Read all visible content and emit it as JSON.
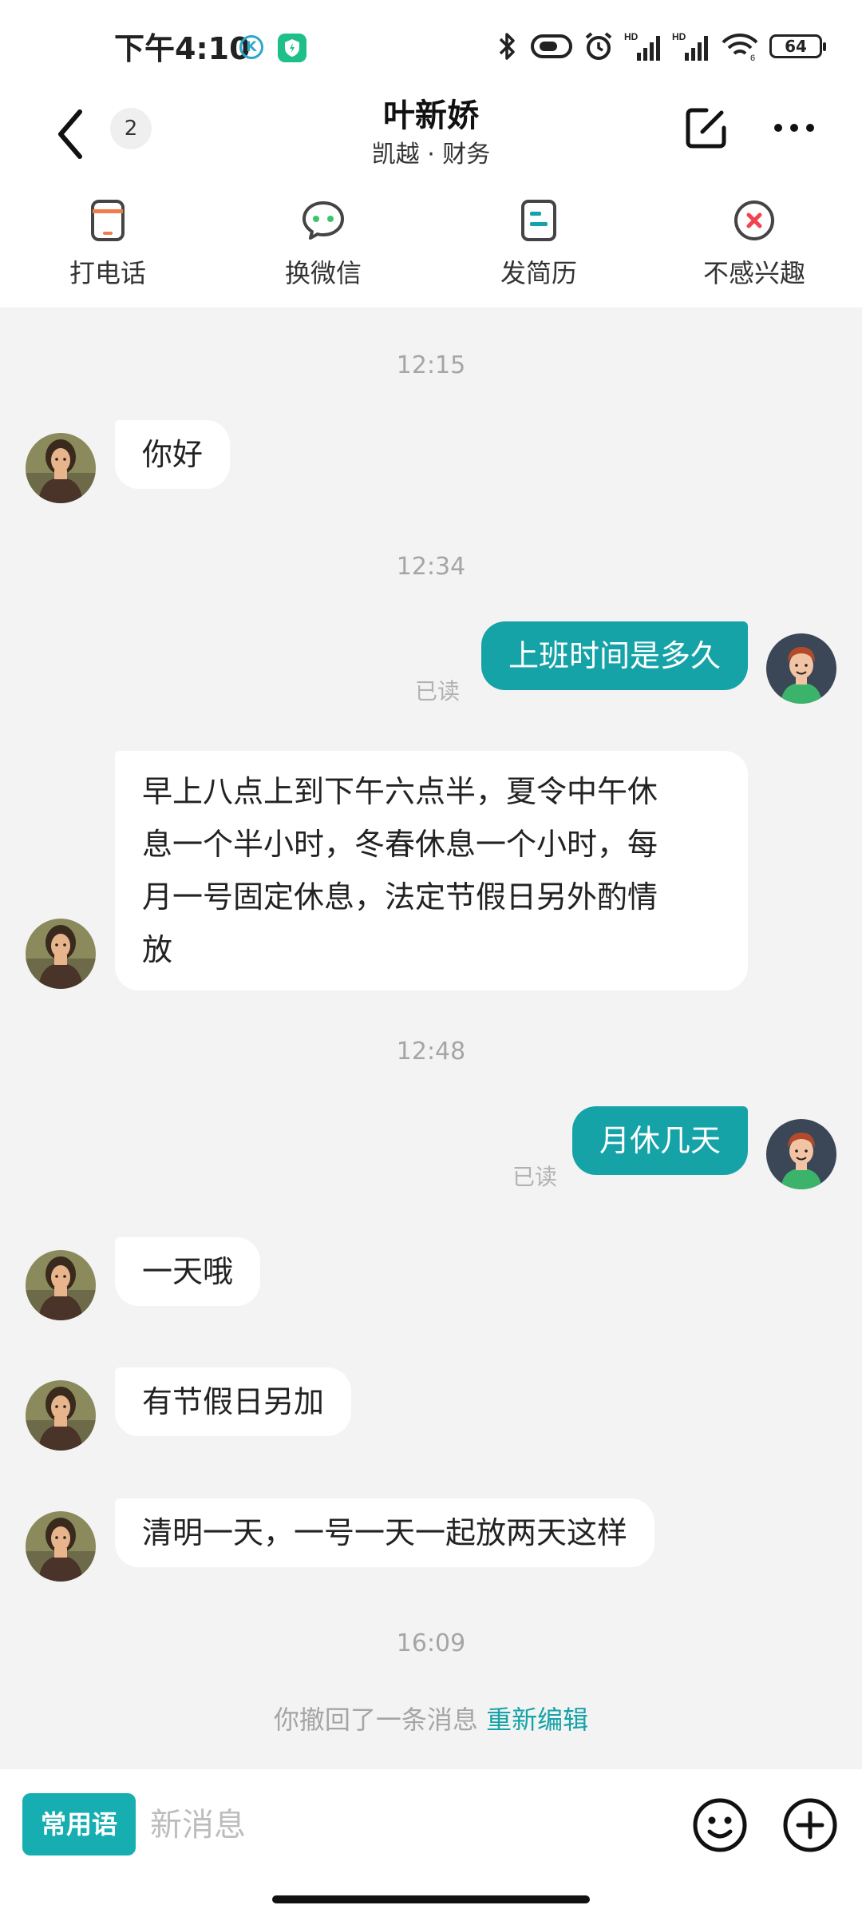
{
  "status_bar": {
    "time": "下午4:10",
    "k_badge": "K",
    "battery": "64",
    "icons": [
      "bluetooth-icon",
      "toggle-icon",
      "alarm-icon",
      "signal-icon",
      "signal-icon",
      "wifi-icon",
      "battery-icon"
    ]
  },
  "header": {
    "back_icon": "chevron-left-icon",
    "unread_count": "2",
    "contact_name": "叶新娇",
    "contact_subtitle": "凯越 · 财务",
    "edit_icon": "edit-icon",
    "more_icon": "more-icon"
  },
  "actions": [
    {
      "label": "打电话",
      "icon": "phone-icon",
      "color": "#f07c4c"
    },
    {
      "label": "换微信",
      "icon": "wechat-icon",
      "color": "#3ec46d"
    },
    {
      "label": "发简历",
      "icon": "resume-icon",
      "color": "#14a3ae"
    },
    {
      "label": "不感兴趣",
      "icon": "not-interested-icon",
      "color": "#f0444f"
    }
  ],
  "messages": [
    {
      "type": "time",
      "text": "12:15"
    },
    {
      "type": "in",
      "text": "你好"
    },
    {
      "type": "time",
      "text": "12:34"
    },
    {
      "type": "out",
      "text": "上班时间是多久",
      "status": "已读"
    },
    {
      "type": "in",
      "lines": [
        "早上八点上到下午六点半，夏令中午休",
        "息一个半小时，冬春休息一个小时，每",
        "月一号固定休息，法定节假日另外酌情",
        "放"
      ]
    },
    {
      "type": "time",
      "text": "12:48"
    },
    {
      "type": "out",
      "text": "月休几天",
      "status": "已读"
    },
    {
      "type": "in",
      "text": "一天哦"
    },
    {
      "type": "in",
      "text": "有节假日另加"
    },
    {
      "type": "in",
      "text": "清明一天，一号一天一起放两天这样"
    },
    {
      "type": "time",
      "text": "16:09"
    },
    {
      "type": "recall",
      "text": "你撤回了一条消息",
      "link": "重新编辑"
    }
  ],
  "input_bar": {
    "phrases_label": "常用语",
    "placeholder": "新消息",
    "emoji_icon": "emoji-icon",
    "plus_icon": "plus-icon"
  },
  "colors": {
    "accent": "#16a3a8",
    "background": "#f3f3f3"
  }
}
